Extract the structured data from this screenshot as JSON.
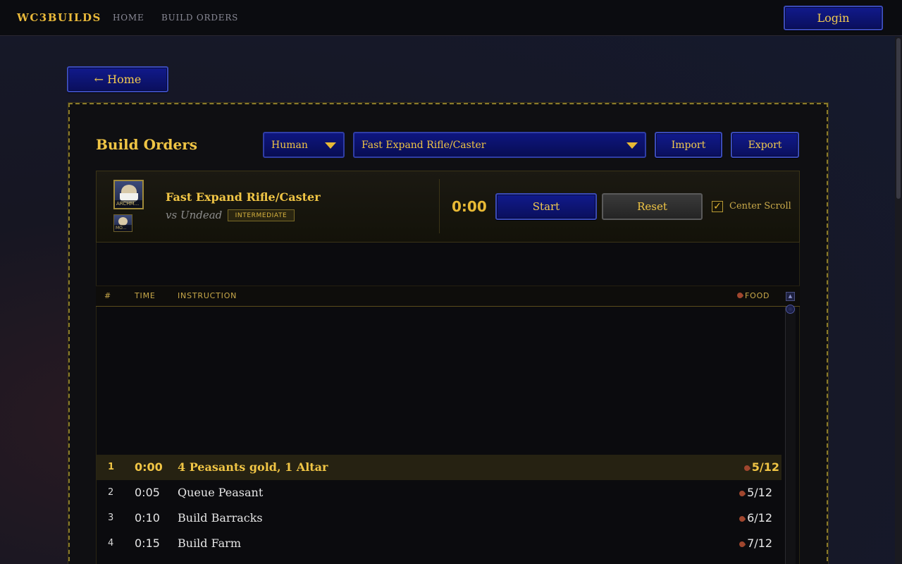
{
  "nav": {
    "brand": "WC3BUILDS",
    "links": [
      "HOME",
      "BUILD ORDERS"
    ],
    "login": "Login"
  },
  "back_button": "← Home",
  "panel": {
    "title": "Build Orders",
    "race_select": "Human",
    "build_select": "Fast Expand Rifle/Caster",
    "import": "Import",
    "export": "Export"
  },
  "build": {
    "name": "Fast Expand Rifle/Caster",
    "matchup": "vs Undead",
    "difficulty": "INTERMEDIATE",
    "hero_main_caption": "ARCHM...",
    "hero_secondary_caption": "MO...",
    "timer": "0:00",
    "start": "Start",
    "reset": "Reset",
    "center_scroll_checked": true,
    "center_scroll_label": "Center Scroll"
  },
  "table": {
    "headers": [
      "#",
      "TIME",
      "INSTRUCTION",
      "FOOD"
    ],
    "rows": [
      {
        "num": "1",
        "time": "0:00",
        "instruction": "4 Peasants gold, 1 Altar",
        "food": "5/12",
        "active": true
      },
      {
        "num": "2",
        "time": "0:05",
        "instruction": "Queue Peasant",
        "food": "5/12",
        "active": false
      },
      {
        "num": "3",
        "time": "0:10",
        "instruction": "Build Barracks",
        "food": "6/12",
        "active": false
      },
      {
        "num": "4",
        "time": "0:15",
        "instruction": "Build Farm",
        "food": "7/12",
        "active": false
      }
    ]
  },
  "colors": {
    "gold": "#f0c545",
    "button_blue": "#0e1680",
    "panel_bg": "#0f0f12"
  }
}
